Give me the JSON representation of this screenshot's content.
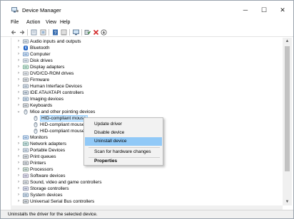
{
  "window": {
    "title": "Device Manager"
  },
  "titlebar": {
    "minimize_glyph": "─",
    "maximize_glyph": "☐",
    "close_glyph": "✕"
  },
  "menu": [
    "File",
    "Action",
    "View",
    "Help"
  ],
  "toolbar": {
    "buttons": [
      "back-arrow-icon",
      "forward-arrow-icon",
      "properties-icon",
      "refresh-icon",
      "help-icon",
      "view-icon",
      "computer-monitor-icon",
      "enable-device-icon",
      "uninstall-x-icon",
      "update-driver-icon"
    ]
  },
  "tree": [
    {
      "label": "Audio inputs and outputs",
      "expand": "›",
      "icon": "audio-icon"
    },
    {
      "label": "Bluetooth",
      "expand": "›",
      "icon": "bluetooth-icon"
    },
    {
      "label": "Computer",
      "expand": "›",
      "icon": "computer-icon"
    },
    {
      "label": "Disk drives",
      "expand": "›",
      "icon": "disk-drive-icon"
    },
    {
      "label": "Display adapters",
      "expand": "›",
      "icon": "display-adapter-icon"
    },
    {
      "label": "DVD/CD-ROM drives",
      "expand": "›",
      "icon": "dvd-drive-icon"
    },
    {
      "label": "Firmware",
      "expand": "›",
      "icon": "firmware-icon"
    },
    {
      "label": "Human Interface Devices",
      "expand": "›",
      "icon": "hid-icon"
    },
    {
      "label": "IDE ATA/ATAPI controllers",
      "expand": "›",
      "icon": "ide-controller-icon"
    },
    {
      "label": "Imaging devices",
      "expand": "›",
      "icon": "camera-icon"
    },
    {
      "label": "Keyboards",
      "expand": "›",
      "icon": "keyboard-icon"
    },
    {
      "label": "Mice and other pointing devices",
      "expand": "⌄",
      "icon": "mouse-icon"
    },
    {
      "label": "HID-compliant mouse",
      "expand": "",
      "icon": "mouse-icon",
      "child": true,
      "selected": true
    },
    {
      "label": "HID-compliant mouse",
      "expand": "",
      "icon": "mouse-icon",
      "child": true
    },
    {
      "label": "HID-compliant mouse",
      "expand": "",
      "icon": "mouse-icon",
      "child": true
    },
    {
      "label": "Monitors",
      "expand": "›",
      "icon": "monitor-icon"
    },
    {
      "label": "Network adapters",
      "expand": "›",
      "icon": "network-adapter-icon"
    },
    {
      "label": "Portable Devices",
      "expand": "›",
      "icon": "portable-device-icon"
    },
    {
      "label": "Print queues",
      "expand": "›",
      "icon": "printer-icon"
    },
    {
      "label": "Printers",
      "expand": "›",
      "icon": "printer-icon"
    },
    {
      "label": "Processors",
      "expand": "›",
      "icon": "processor-icon"
    },
    {
      "label": "Software devices",
      "expand": "›",
      "icon": "software-device-icon"
    },
    {
      "label": "Sound, video and game controllers",
      "expand": "›",
      "icon": "sound-icon"
    },
    {
      "label": "Storage controllers",
      "expand": "›",
      "icon": "storage-controller-icon"
    },
    {
      "label": "System devices",
      "expand": "›",
      "icon": "system-device-icon"
    },
    {
      "label": "Universal Serial Bus controllers",
      "expand": "›",
      "icon": "usb-icon"
    }
  ],
  "context_menu": {
    "items": [
      {
        "label": "Update driver"
      },
      {
        "label": "Disable device"
      },
      {
        "label": "Uninstall device",
        "highlighted": true
      },
      {
        "label": "Scan for hardware changes"
      },
      {
        "label": "Properties",
        "bold": true
      }
    ]
  },
  "status": {
    "text": "Uninstalls the driver for the selected device."
  },
  "colors": {
    "selection": "#cce8ff",
    "menu_highlight": "#91c9f7",
    "uninstall_red": "#d32f2f",
    "enable_green": "#2e7d32"
  }
}
